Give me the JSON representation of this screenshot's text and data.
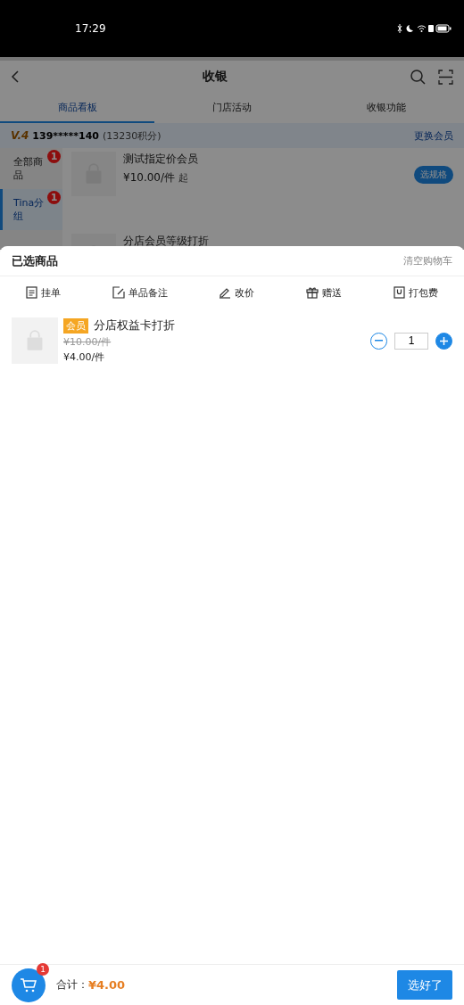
{
  "status_bar": {
    "time": "17:29"
  },
  "header": {
    "title": "收银"
  },
  "tabs": [
    {
      "label": "商品看板",
      "selected": true
    },
    {
      "label": "门店活动",
      "selected": false
    },
    {
      "label": "收银功能",
      "selected": false
    }
  ],
  "member": {
    "level": "V.4",
    "phone": "139*****140",
    "points": "(13230积分)",
    "change": "更换会员"
  },
  "categories": [
    {
      "label": "全部商品",
      "badge": "1",
      "selected": false
    },
    {
      "label": "Tina分组",
      "badge": "1",
      "selected": true
    }
  ],
  "products": [
    {
      "name": "测试指定价会员",
      "price": "¥10.00/件",
      "suffix": "起",
      "action": "选规格"
    },
    {
      "name": "分店会员等级打折"
    }
  ],
  "sheet": {
    "title": "已选商品",
    "clear": "清空购物车",
    "actions": [
      {
        "kind": "hold",
        "label": "挂单"
      },
      {
        "kind": "note",
        "label": "单品备注"
      },
      {
        "kind": "price",
        "label": "改价"
      },
      {
        "kind": "gift",
        "label": "赠送"
      },
      {
        "kind": "pack",
        "label": "打包费"
      }
    ],
    "items": [
      {
        "tag": "会员",
        "name": "分店权益卡打折",
        "original_price": "¥10.00/件",
        "price": "¥4.00/件",
        "quantity": "1"
      }
    ]
  },
  "footer": {
    "cart_count": "1",
    "total_label": "合计：",
    "total": "¥4.00",
    "confirm": "选好了"
  }
}
